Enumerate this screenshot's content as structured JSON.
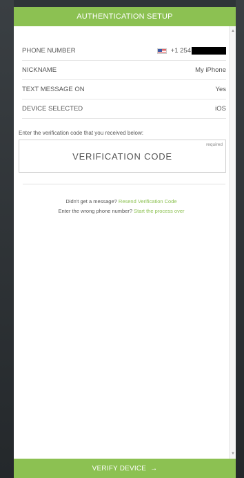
{
  "header": {
    "title": "AUTHENTICATION SETUP"
  },
  "details": [
    {
      "label": "PHONE NUMBER",
      "value": "+1 254"
    },
    {
      "label": "NICKNAME",
      "value": "My iPhone"
    },
    {
      "label": "TEXT MESSAGE ON",
      "value": "Yes"
    },
    {
      "label": "DEVICE SELECTED",
      "value": "iOS"
    }
  ],
  "verification": {
    "instruction": "Enter the verification code that you received below:",
    "placeholder": "VERIFICATION CODE",
    "required_label": "required"
  },
  "help": {
    "resend_prompt": "Didn't get a message?",
    "resend_link": "Resend Verification Code",
    "restart_prompt": "Enter the wrong phone number?",
    "restart_link": "Start the process over"
  },
  "footer": {
    "label": "VERIFY DEVICE",
    "arrow": "→"
  },
  "colors": {
    "accent": "#8cc152",
    "text": "#555555"
  }
}
